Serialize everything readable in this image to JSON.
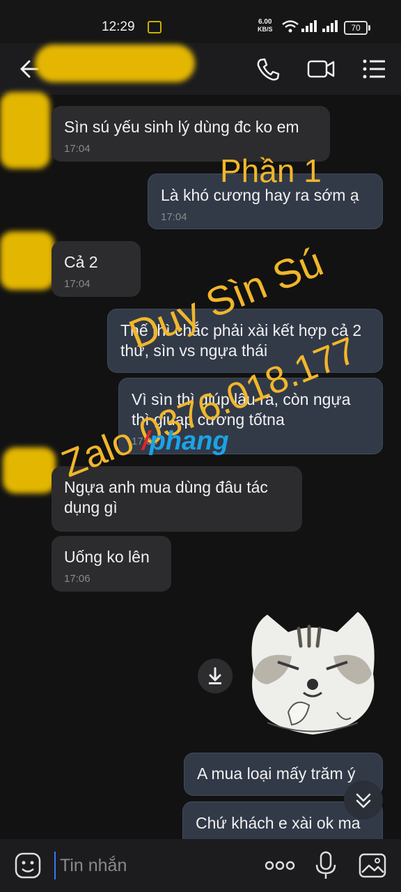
{
  "status_bar": {
    "time": "12:29",
    "net_speed_value": "6.00",
    "net_speed_unit": "KB/S",
    "battery": "70"
  },
  "header": {
    "back_icon": "arrow-left-icon",
    "call_icon": "phone-icon",
    "video_icon": "video-camera-icon",
    "menu_icon": "menu-list-icon"
  },
  "messages": [
    {
      "direction": "received",
      "text": "Sìn sú yếu sinh lý dùng đc ko em",
      "time": "17:04"
    },
    {
      "direction": "sent",
      "text": "Là khó cương hay ra sớm ạ",
      "time": "17:04"
    },
    {
      "direction": "received",
      "text": "Cả 2",
      "time": "17:04"
    },
    {
      "direction": "sent",
      "text": "Thế thì chắc phải xài kết hợp cả 2 thứ, sìn vs ngựa thái",
      "time": ""
    },
    {
      "direction": "sent",
      "text": "Vì sìn thì giúp lâu ra, còn ngựa thì giuap cương tốtna",
      "time": "17:06"
    },
    {
      "direction": "received",
      "text": "Ngựa anh mua dùng đâu tác dụng gì",
      "time": ""
    },
    {
      "direction": "received",
      "text": "Uống ko lên",
      "time": "17:06"
    },
    {
      "direction": "sent",
      "text": "A mua loại mấy trăm ý",
      "time": ""
    },
    {
      "direction": "sent",
      "text": "Chứ khách e xài ok ma",
      "time": ""
    }
  ],
  "sticker": {
    "icon": "grumpy-cat-sticker"
  },
  "watermarks": {
    "part": "Phần 1",
    "name": "Duy Sìn Sú",
    "zalo": "Zalo 0376.018.177",
    "logo": "phang"
  },
  "input_bar": {
    "placeholder": "Tin nhắn",
    "emoji_icon": "emoji-icon",
    "more_icon": "more-dots-icon",
    "mic_icon": "microphone-icon",
    "image_icon": "image-icon"
  },
  "colors": {
    "watermark": "#f1b62a",
    "accent": "#2f7cf6",
    "logo_blue": "#1aa3e8",
    "logo_red": "#e0242a"
  }
}
